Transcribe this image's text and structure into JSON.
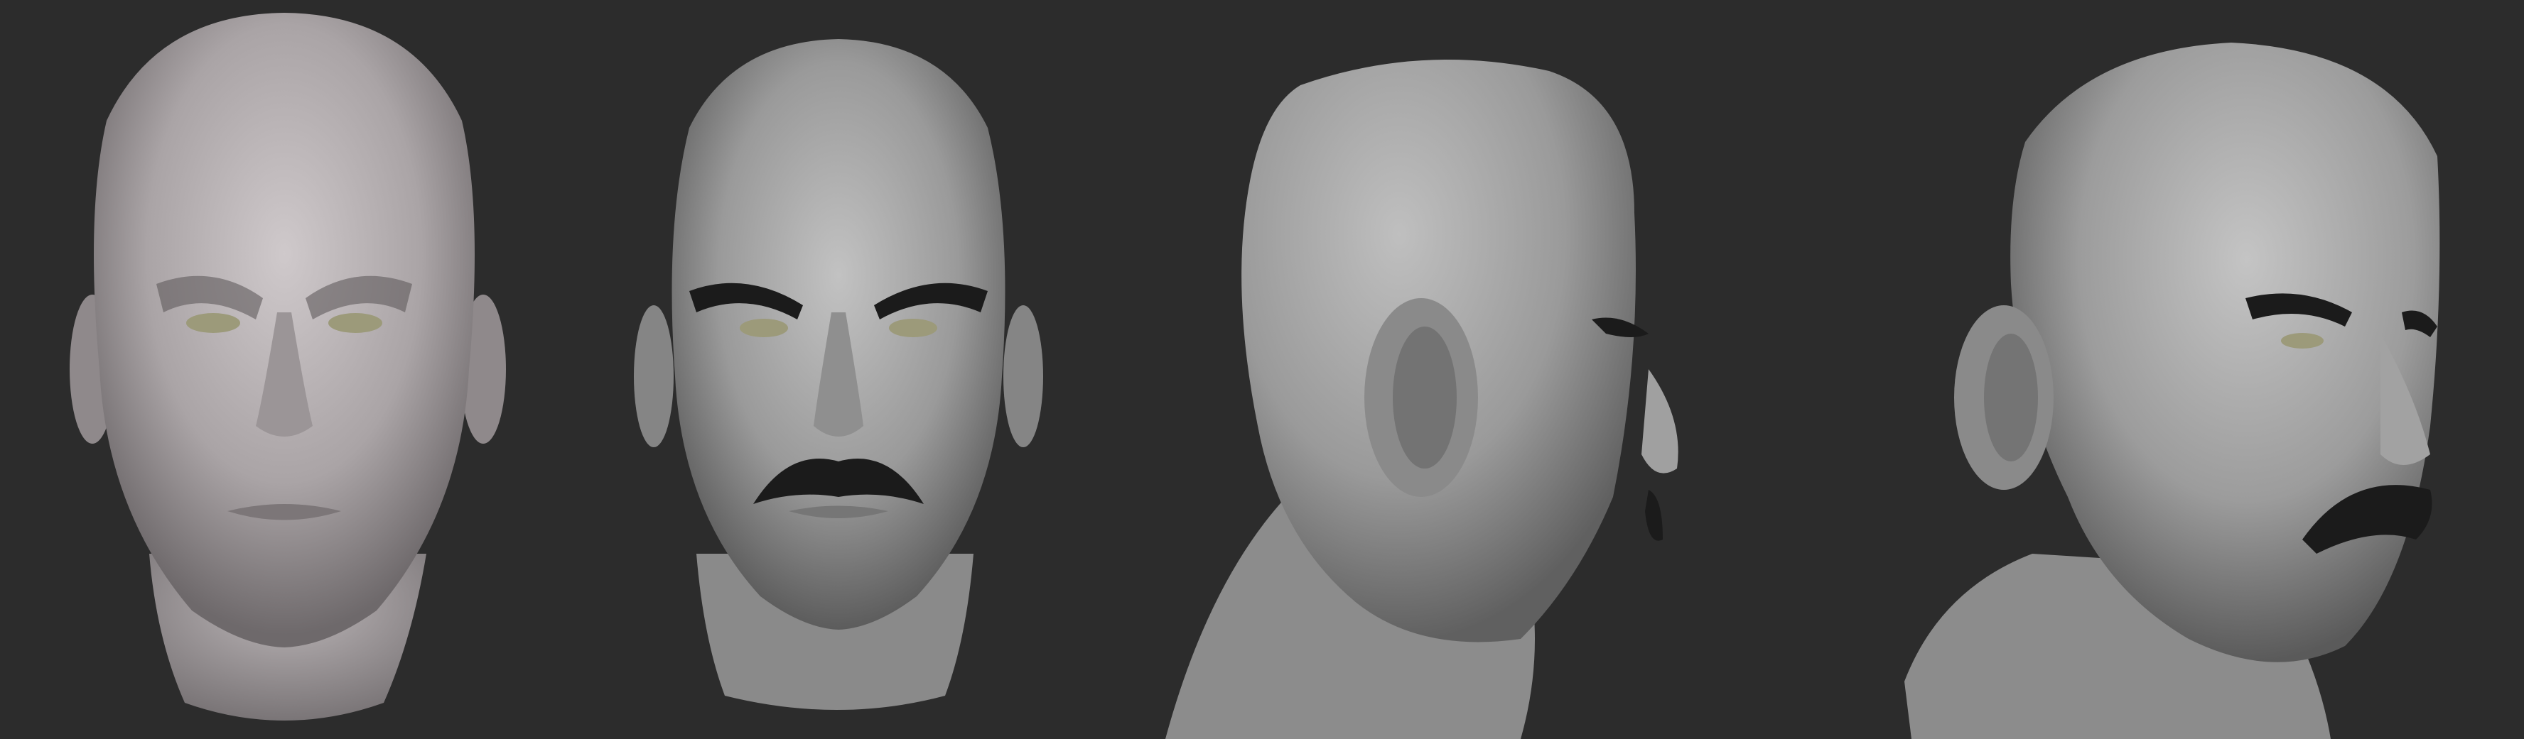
{
  "canvas": {
    "background": "#2c2c2c"
  },
  "renders": [
    {
      "view": "front",
      "material": "skin-clay",
      "facial_hair": "none"
    },
    {
      "view": "front",
      "material": "grey-clay",
      "facial_hair": "mustache"
    },
    {
      "view": "side-back",
      "material": "grey-clay",
      "facial_hair": "mustache"
    },
    {
      "view": "three-quarter",
      "material": "grey-clay",
      "facial_hair": "mustache"
    }
  ],
  "colors": {
    "skin_clay": "#b7b1b3",
    "grey_clay": "#a8a8a8",
    "hair": "#1b1b1b",
    "eye": "#9c9a7a"
  }
}
